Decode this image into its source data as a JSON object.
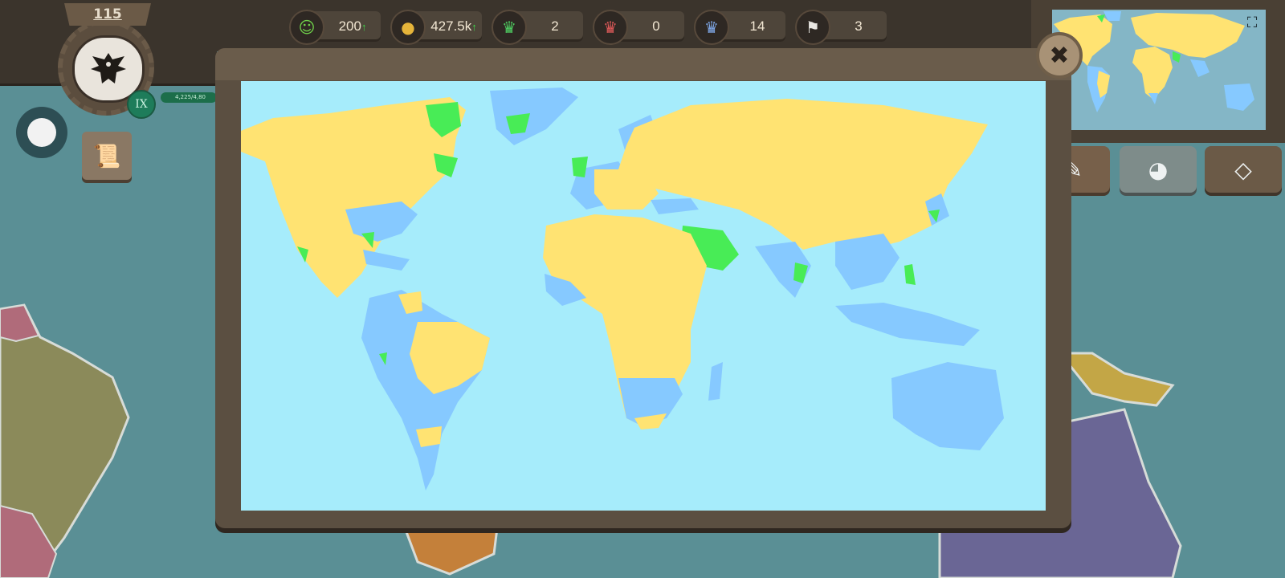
{
  "player": {
    "level": "115",
    "rank": "IX",
    "xp_text": "4,225/4,80"
  },
  "resources": [
    {
      "icon": "happiness-icon",
      "glyph": "☺",
      "value": "200",
      "trend": "↑"
    },
    {
      "icon": "gold-coins-icon",
      "glyph": "●",
      "value": "427.5k",
      "trend": "↑"
    },
    {
      "icon": "green-crown-icon",
      "glyph": "♛",
      "value": "2",
      "trend": ""
    },
    {
      "icon": "red-crown-icon",
      "glyph": "♛",
      "value": "0",
      "trend": ""
    },
    {
      "icon": "blue-crown-icon",
      "glyph": "♛",
      "value": "14",
      "trend": ""
    },
    {
      "icon": "japan-flag-icon",
      "glyph": "⚑",
      "value": "3",
      "trend": ""
    }
  ],
  "colors": {
    "ocean": "#a6ecfb",
    "owned": "#ffe372",
    "allied": "#48ec56",
    "other": "#86c9ff"
  },
  "icons": {
    "close": "close-icon",
    "expand": "expand-icon",
    "pencil": "pencil-icon",
    "globe": "globe-icon",
    "diamond": "diamond-icon",
    "scroll": "scroll-icon"
  }
}
